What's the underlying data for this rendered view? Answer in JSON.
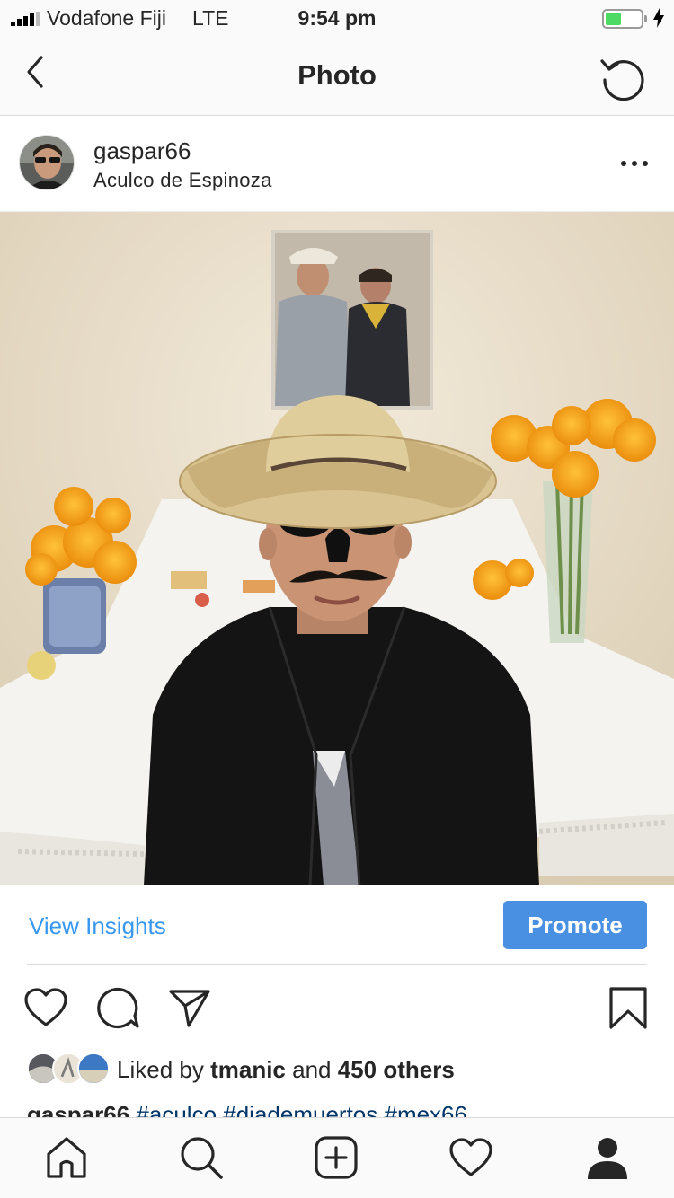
{
  "status_bar": {
    "carrier": "Vodafone Fiji",
    "network": "LTE",
    "time": "9:54 pm",
    "battery_level": 0.45
  },
  "nav": {
    "title": "Photo",
    "back_icon": "chevron-left-icon",
    "refresh_icon": "refresh-icon"
  },
  "post": {
    "username": "gaspar66",
    "location": "Aculco de Espinoza",
    "more_icon": "ellipsis-icon",
    "photo_subject": "person-in-sombrero-photo"
  },
  "insights": {
    "view_label": "View Insights",
    "promote_label": "Promote"
  },
  "actions": {
    "like_icon": "heart-icon",
    "comment_icon": "comment-icon",
    "share_icon": "paper-plane-icon",
    "save_icon": "bookmark-icon"
  },
  "likes": {
    "prefix": "Liked by ",
    "top_liker": "tmanic",
    "conjunction": " and ",
    "others": "450 others"
  },
  "caption": {
    "username": "gaspar66",
    "hashtags": "#aculco #diademuertos #mex66"
  },
  "tab_bar": {
    "items": [
      "home-icon",
      "search-icon",
      "new-post-icon",
      "activity-heart-icon",
      "profile-icon"
    ]
  },
  "colors": {
    "accent_blue": "#3897f0",
    "promote_blue": "#4a90e2",
    "battery_green": "#4cd964",
    "hashtag_blue": "#003569"
  }
}
